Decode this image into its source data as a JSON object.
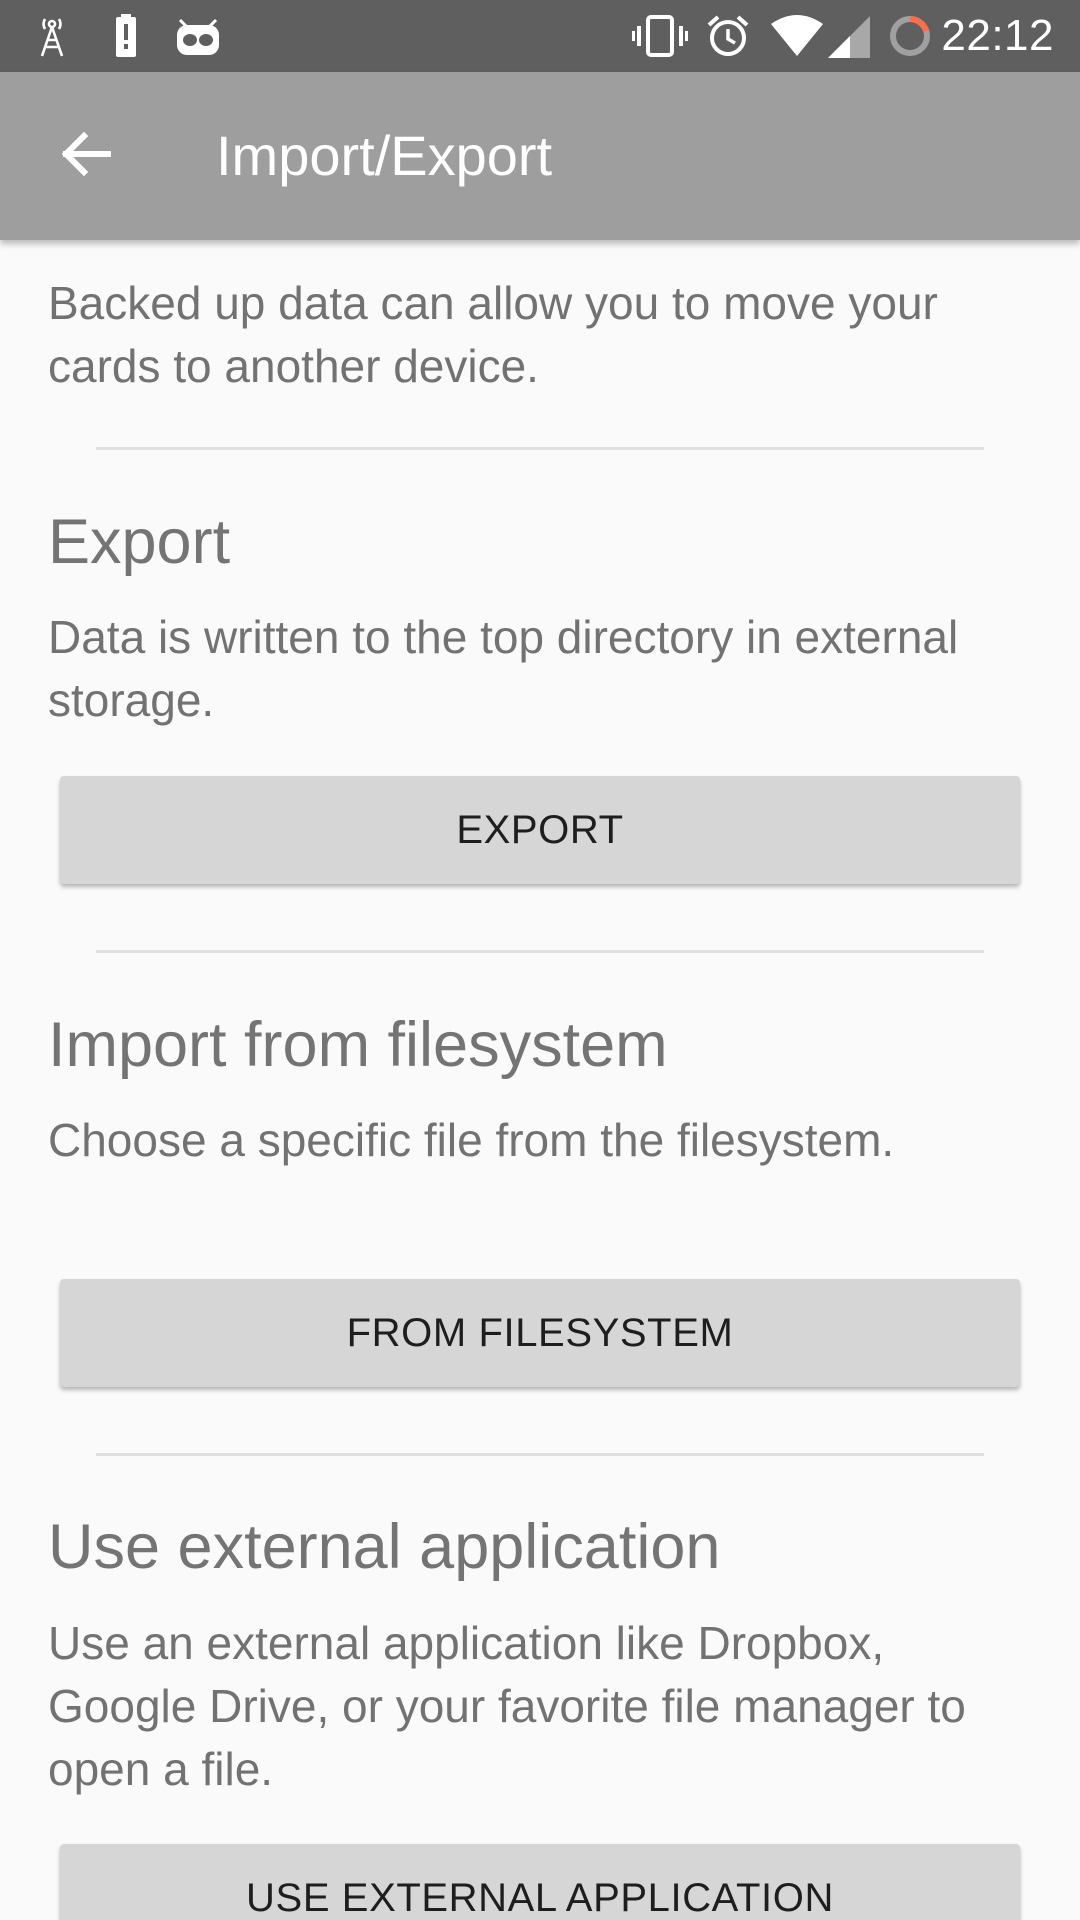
{
  "status_bar": {
    "time": "22:12",
    "icons": [
      "antenna-icon",
      "battery-alert-icon",
      "cyanogen-mascot-icon",
      "vibrate-icon",
      "alarm-icon",
      "wifi-icon",
      "cell-signal-icon",
      "loading-ring-icon"
    ]
  },
  "app_bar": {
    "title": "Import/Export",
    "back_icon": "arrow-back-icon"
  },
  "intro": {
    "text": "Backed up data can allow you to move your cards to another device."
  },
  "export": {
    "heading": "Export",
    "description": "Data is written to the top directory in external storage.",
    "button": "EXPORT"
  },
  "import_filesystem": {
    "heading": "Import from filesystem",
    "description": "Choose a specific file from the filesystem.",
    "button": "FROM FILESYSTEM"
  },
  "import_external": {
    "heading": "Use external application",
    "description": "Use an external application like Dropbox, Google Drive, or your favorite file manager to open a file.",
    "button": "USE EXTERNAL APPLICATION"
  },
  "colors": {
    "status_bar": "#5f5f5f",
    "app_bar": "#9e9e9e",
    "background": "#fafafa",
    "button": "#d6d6d6",
    "ring_accent": "#ff6d4d"
  }
}
